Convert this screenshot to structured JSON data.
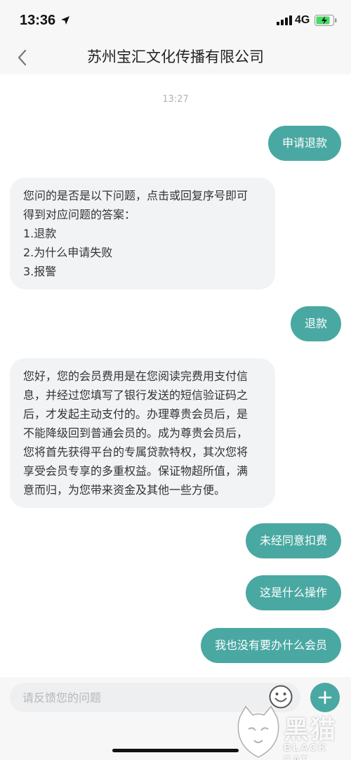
{
  "status_bar": {
    "time": "13:36",
    "network": "4G"
  },
  "header": {
    "title": "苏州宝汇文化传播有限公司"
  },
  "messages": [
    {
      "type": "timestamp",
      "text": "13:27"
    },
    {
      "type": "user",
      "text": "申请退款"
    },
    {
      "type": "bot",
      "lines": [
        "您问的是否是以下问题，点击或回复序号即可",
        "得到对应问题的答案：",
        "1.退款",
        "2.为什么申请失败",
        "3.报警"
      ]
    },
    {
      "type": "user",
      "text": "退款"
    },
    {
      "type": "bot",
      "lines": [
        "您好，您的会员费用是在您阅读完费用支付信",
        "息，并经过您填写了银行发送的短信验证码之",
        "后，才发起主动支付的。办理尊贵会员后，是",
        "不能降级回到普通会员的。成为尊贵会员后，",
        "您将首先获得平台的专属贷款特权，其次您将",
        "享受会员专享的多重权益。保证物超所值，满",
        "意而归，为您带来资金及其他一些方便。"
      ]
    },
    {
      "type": "user",
      "text": "未经同意扣费"
    },
    {
      "type": "user",
      "text": "这是什么操作"
    },
    {
      "type": "user",
      "text": "我也没有要办什么会员"
    }
  ],
  "input": {
    "placeholder": "请反馈您的问题"
  },
  "icons": {
    "back": "chevron-left-icon",
    "emoji": "smiley-icon",
    "add": "plus-icon"
  },
  "watermark": {
    "cn": "黑猫",
    "en": "BLACK CAT"
  },
  "colors": {
    "accent": "#4aa8a2",
    "bot_bubble": "#f2f3f5",
    "header_bg": "#f7f7f7"
  }
}
